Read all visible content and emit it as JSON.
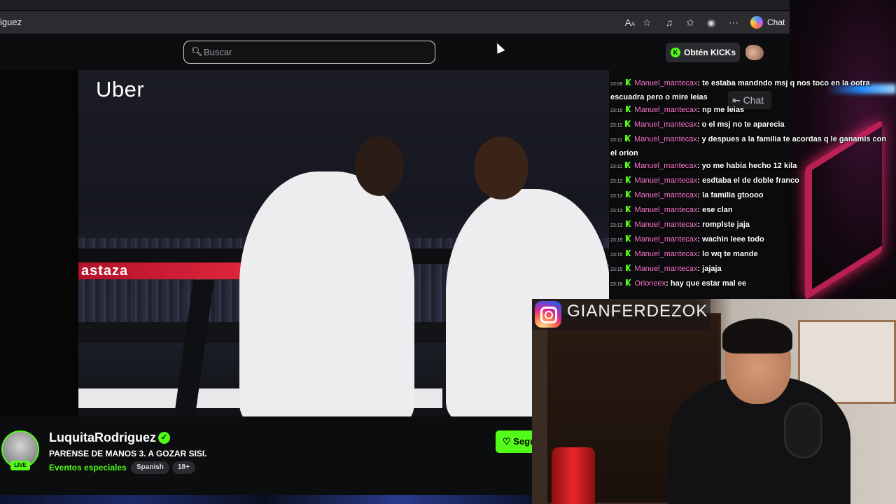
{
  "browser": {
    "url_fragment": "iguez",
    "copilot_label": "Chat"
  },
  "header": {
    "search_placeholder": "Buscar",
    "kicks_button": "Obtén KICKs"
  },
  "video": {
    "sponsor": "Uber",
    "ring_banner": "astaza"
  },
  "chat": {
    "overlay_label": "Chat",
    "messages": [
      {
        "time": "23:09",
        "user": "Manuel_mantecax",
        "text": ": te estaba mandndo msj q nos toco en la ootra escuadra pero o mire leias"
      },
      {
        "time": "23:10",
        "user": "Manuel_mantecax",
        "text": ": np me leias"
      },
      {
        "time": "23:11",
        "user": "Manuel_mantecax",
        "text": ": o el msj no te aparecia"
      },
      {
        "time": "23:11",
        "user": "Manuel_mantecax",
        "text": ": y despues a la familia te acordas q le ganamis con el orion"
      },
      {
        "time": "23:11",
        "user": "Manuel_mantecax",
        "text": ": yo me habia hecho 12 kila"
      },
      {
        "time": "23:12",
        "user": "Manuel_mantecax",
        "text": ": esdtaba el de doble franco"
      },
      {
        "time": "23:13",
        "user": "Manuel_mantecax",
        "text": ": la familia gtoooo"
      },
      {
        "time": "23:13",
        "user": "Manuel_mantecax",
        "text": ": ese clan"
      },
      {
        "time": "23:13",
        "user": "Manuel_mantecax",
        "text": ": romplste jaja"
      },
      {
        "time": "23:15",
        "user": "Manuel_mantecax",
        "text": ": wachin leee todo"
      },
      {
        "time": "23:15",
        "user": "Manuel_mantecax",
        "text": ": lo wq te mande"
      },
      {
        "time": "23:15",
        "user": "Manuel_mantecax",
        "text": ": jajaja"
      },
      {
        "time": "23:16",
        "user": "Orioneex",
        "text": ": hay que estar mal ee"
      }
    ]
  },
  "webcam": {
    "instagram_handle": "GIANFERDEZOK"
  },
  "stream_info": {
    "live_label": "LIVE",
    "streamer_name": "LuquitaRodriguez",
    "title": "PARENSE DE MANOS 3. A GOZAR SISI.",
    "category": "Eventos especiales",
    "tags": [
      "Spanish",
      "18+"
    ],
    "follow_label": "Seguir"
  },
  "colors": {
    "kick_green": "#53fc18",
    "chat_user": "#ff7bd0"
  }
}
